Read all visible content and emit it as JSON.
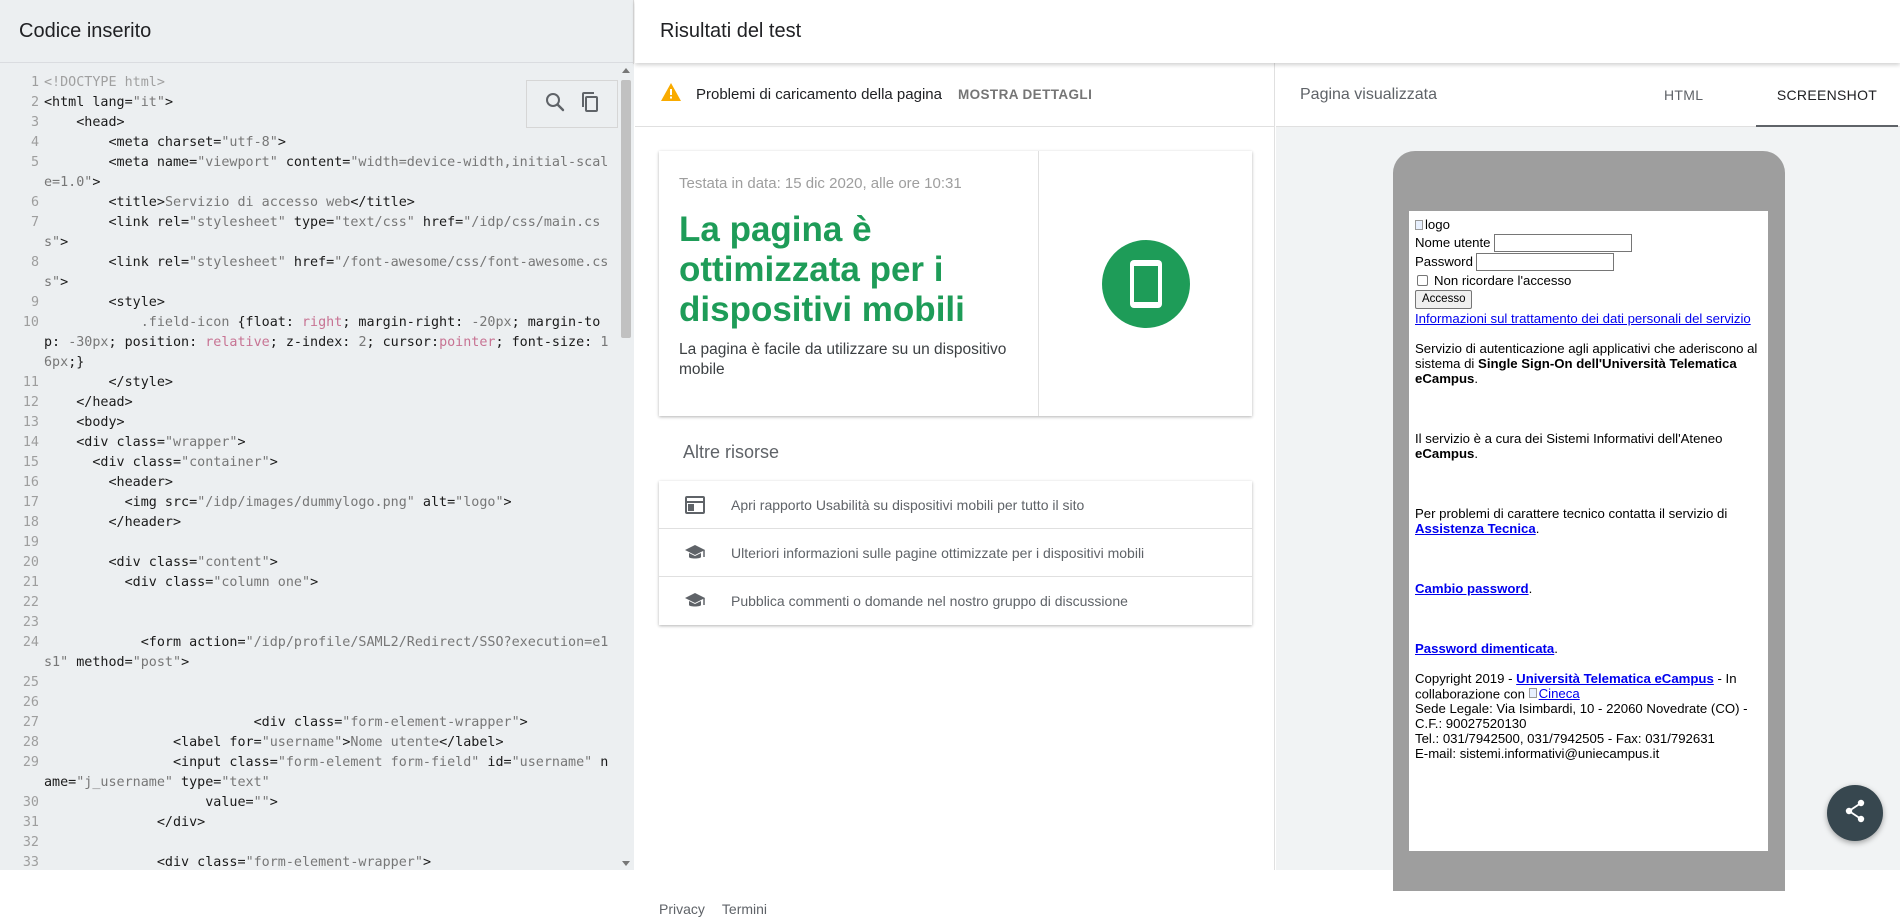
{
  "left": {
    "title": "Codice inserito",
    "code_lines": [
      {
        "n": "1",
        "html": "<span class=\"ctk\">&lt;!DOCTYPE html&gt;</span>"
      },
      {
        "n": "2",
        "html": "&lt;html lang=<span class=\"cs\">\"it\"</span>&gt;"
      },
      {
        "n": "3",
        "html": "    &lt;head&gt;"
      },
      {
        "n": "4",
        "html": "        &lt;meta charset=<span class=\"cs\">\"utf-8\"</span>&gt;"
      },
      {
        "n": "5",
        "html": "        &lt;meta name=<span class=\"cs\">\"viewport\"</span> content=<span class=\"cs\">\"width=device-width,initial-scale=1.0\"</span>&gt;"
      },
      {
        "n": "6",
        "html": "        &lt;title&gt;<span class=\"cs\">Servizio di accesso web</span>&lt;/title&gt;"
      },
      {
        "n": "7",
        "html": "        &lt;link rel=<span class=\"cs\">\"stylesheet\"</span> type=<span class=\"cs\">\"text/css\"</span> href=<span class=\"cs\">\"/idp/css/main.css\"</span>&gt;"
      },
      {
        "n": "8",
        "html": "        &lt;link rel=<span class=\"cs\">\"stylesheet\"</span> href=<span class=\"cs\">\"/font-awesome/css/font-awesome.css\"</span>&gt;"
      },
      {
        "n": "9",
        "html": "        &lt;style&gt;"
      },
      {
        "n": "10",
        "html": "            <span class=\"cs\">.field-icon</span> {float: <span class=\"cv\">right</span>; margin-right: <span class=\"cs\">-20px</span>; margin-top: <span class=\"cs\">-30px</span>; position: <span class=\"cv\">relative</span>; z-index: <span class=\"cs\">2</span>; cursor:<span class=\"cv\">pointer</span>; font-size: <span class=\"cs\">16px</span>;}"
      },
      {
        "n": "11",
        "html": "        &lt;/style&gt;"
      },
      {
        "n": "12",
        "html": "    &lt;/head&gt;"
      },
      {
        "n": "13",
        "html": "    &lt;body&gt;"
      },
      {
        "n": "14",
        "html": "    &lt;div class=<span class=\"cs\">\"wrapper\"</span>&gt;"
      },
      {
        "n": "15",
        "html": "      &lt;div class=<span class=\"cs\">\"container\"</span>&gt;"
      },
      {
        "n": "16",
        "html": "        &lt;header&gt;"
      },
      {
        "n": "17",
        "html": "          &lt;img src=<span class=\"cs\">\"/idp/images/dummylogo.png\"</span> alt=<span class=\"cs\">\"logo\"</span>&gt;"
      },
      {
        "n": "18",
        "html": "        &lt;/header&gt;"
      },
      {
        "n": "19",
        "html": ""
      },
      {
        "n": "20",
        "html": "        &lt;div class=<span class=\"cs\">\"content\"</span>&gt;"
      },
      {
        "n": "21",
        "html": "          &lt;div class=<span class=\"cs\">\"column one\"</span>&gt;"
      },
      {
        "n": "22",
        "html": ""
      },
      {
        "n": "23",
        "html": ""
      },
      {
        "n": "24",
        "html": "            &lt;form action=<span class=\"cs\">\"/idp/profile/SAML2/Redirect/SSO?execution=e1s1\"</span> method=<span class=\"cs\">\"post\"</span>&gt;"
      },
      {
        "n": "25",
        "html": ""
      },
      {
        "n": "26",
        "html": ""
      },
      {
        "n": "27",
        "html": "                          &lt;div class=<span class=\"cs\">\"form-element-wrapper\"</span>&gt;"
      },
      {
        "n": "28",
        "html": "                &lt;label for=<span class=\"cs\">\"username\"</span>&gt;<span class=\"cs\">Nome utente</span>&lt;/label&gt;"
      },
      {
        "n": "29",
        "html": "                &lt;input class=<span class=\"cs\">\"form-element form-field\"</span> id=<span class=\"cs\">\"username\"</span> name=<span class=\"cs\">\"j_username\"</span> type=<span class=\"cs\">\"text\"</span>"
      },
      {
        "n": "30",
        "html": "                    value=<span class=\"cs\">\"\"</span>&gt;"
      },
      {
        "n": "31",
        "html": "              &lt;/div&gt;"
      },
      {
        "n": "32",
        "html": ""
      },
      {
        "n": "33",
        "html": "              &lt;div class=<span class=\"cs\">\"form-element-wrapper\"</span>&gt;"
      }
    ]
  },
  "right": {
    "title": "Risultati del test",
    "problem": {
      "text": "Problemi di caricamento della pagina",
      "link": "MOSTRA DETTAGLI"
    },
    "result": {
      "tested_date": "Testata in data: 15 dic 2020, alle ore 10:31",
      "verdict": "La pagina è ottimizzata per i dispositivi mobili",
      "subtitle": "La pagina è facile da utilizzare su un dispositivo mobile"
    },
    "resources_title": "Altre risorse",
    "resources": [
      {
        "icon": "report-icon",
        "label": "Apri rapporto Usabilità su dispositivi mobili per tutto il sito"
      },
      {
        "icon": "school-icon",
        "label": "Ulteriori informazioni sulle pagine ottimizzate per i dispositivi mobili"
      },
      {
        "icon": "school-icon",
        "label": "Pubblica commenti o domande nel nostro gruppo di discussione"
      }
    ],
    "footer": {
      "privacy": "Privacy",
      "terms": "Termini"
    }
  },
  "rendered": {
    "title": "Pagina visualizzata",
    "tabs": {
      "html": "HTML",
      "screenshot": "SCREENSHOT"
    },
    "page": {
      "logo_alt": "logo",
      "username_label": "Nome utente",
      "password_label": "Password",
      "remember_label": "Non ricordare l'accesso",
      "login_button": "Accesso",
      "privacy_link": "Informazioni sul trattamento dei dati personali del servizio",
      "para1_a": "Servizio di autenticazione agli applicativi che aderiscono al sistema di ",
      "para1_b": "Single Sign-On dell'Università Telematica eCampus",
      "para1_c": ".",
      "para2_a": "Il servizio è a cura dei Sistemi Informativi dell'Ateneo ",
      "para2_b": "eCampus",
      "para2_c": ".",
      "para3_a": "Per problemi di carattere tecnico contatta il servizio di ",
      "para3_link": "Assistenza Tecnica",
      "para3_c": ".",
      "change_password": "Cambio password",
      "forgot_password": "Password dimenticata",
      "dot": ".",
      "copyright_a": "Copyright 2019 - ",
      "copyright_link": "Università Telematica eCampus",
      "copyright_b": " - In collaborazione con ",
      "cineca": "Cineca",
      "address": "Sede Legale: Via Isimbardi, 10 - 22060 Novedrate (CO) - C.F.: 90027520130",
      "phone": "Tel.: 031/7942500, 031/7942505 - Fax: 031/792631",
      "email": "E-mail: sistemi.informativi@uniecampus.it"
    }
  },
  "colors": {
    "accent_green": "#1e9c58",
    "warning": "#f9ab00",
    "fab": "#37474f"
  }
}
